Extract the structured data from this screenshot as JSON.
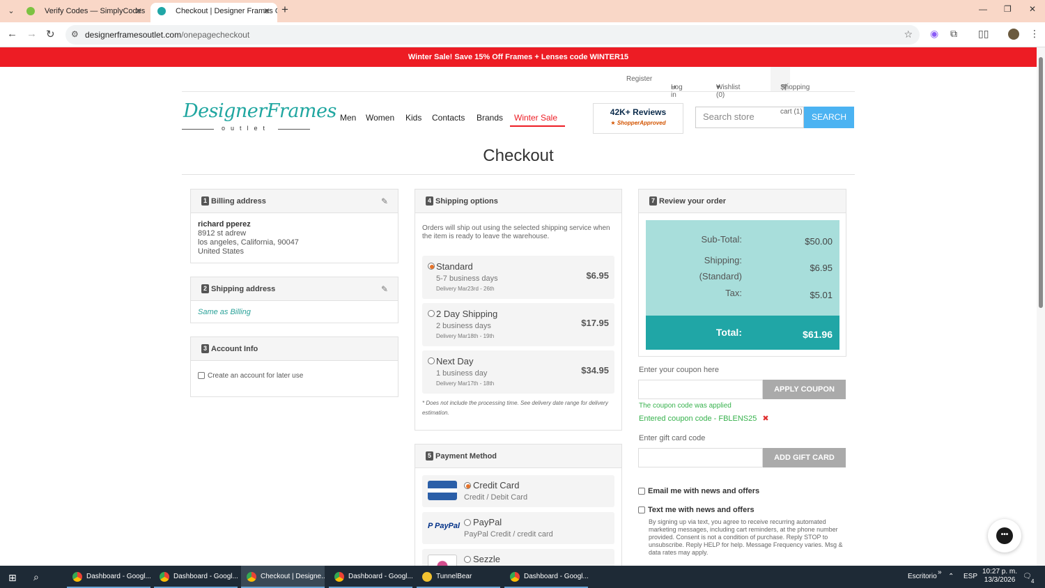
{
  "browser": {
    "tabs": [
      {
        "label": "Verify Codes — SimplyCodes",
        "active": false
      },
      {
        "label": "Checkout | Designer Frames Ou",
        "active": true
      }
    ],
    "url_host": "designerframesoutlet.com",
    "url_path": "/onepagecheckout"
  },
  "promo_banner": "Winter Sale! Save 15% Off Frames + Lenses code WINTER15",
  "top_links": {
    "register": "Register",
    "login": "Log in",
    "wishlist": "Wishlist (0)",
    "cart": "Shopping cart (1)"
  },
  "logo": {
    "word": "DesignerFrames",
    "sub": "outlet"
  },
  "nav": [
    "Men",
    "Women",
    "Kids",
    "Contacts",
    "Brands",
    "Winter Sale"
  ],
  "reviews": {
    "count": "42K+ Reviews",
    "badge": "ShopperApproved"
  },
  "search": {
    "placeholder": "Search store",
    "button": "SEARCH"
  },
  "page_title": "Checkout",
  "billing": {
    "step": "1",
    "title": "Billing address",
    "name": "richard pperez",
    "street": "8912 st adrew",
    "city_line": "los angeles, California, 90047",
    "country": "United States"
  },
  "shipping_address": {
    "step": "2",
    "title": "Shipping address",
    "value": "Same as Billing"
  },
  "account": {
    "step": "3",
    "title": "Account Info",
    "checkbox_label": "Create an account for later use"
  },
  "shipping_options": {
    "step": "4",
    "title": "Shipping options",
    "note": "Orders will ship out using the selected shipping service when the item is ready to leave the warehouse.",
    "options": [
      {
        "name": "Standard",
        "days": "5-7 business days",
        "delivery": "Delivery Mar23rd - 26th",
        "price": "$6.95",
        "selected": true
      },
      {
        "name": "2 Day Shipping",
        "days": "2 business days",
        "delivery": "Delivery Mar18th - 19th",
        "price": "$17.95",
        "selected": false
      },
      {
        "name": "Next Day",
        "days": "1 business day",
        "delivery": "Delivery Mar17th - 18th",
        "price": "$34.95",
        "selected": false
      }
    ],
    "fine_print": "* Does not include the processing time. See delivery date range for delivery estimation."
  },
  "payment": {
    "step": "5",
    "title": "Payment Method",
    "methods": [
      {
        "name": "Credit Card",
        "sub": "Credit / Debit Card",
        "selected": true
      },
      {
        "name": "PayPal",
        "sub": "PayPal Credit / credit card",
        "selected": false
      },
      {
        "name": "Sezzle",
        "sub": "",
        "selected": false
      }
    ]
  },
  "review": {
    "step": "7",
    "title": "Review your order",
    "subtotal_label": "Sub-Total:",
    "subtotal": "$50.00",
    "shipping_label": "Shipping:",
    "shipping_method": "(Standard)",
    "shipping": "$6.95",
    "tax_label": "Tax:",
    "tax": "$5.01",
    "total_label": "Total:",
    "total": "$61.96"
  },
  "coupon": {
    "label": "Enter your coupon here",
    "button": "APPLY COUPON",
    "applied_msg": "The coupon code was applied",
    "entered": "Entered coupon code - FBLENS25",
    "remove": "✖"
  },
  "gift": {
    "label": "Enter gift card code",
    "button": "ADD GIFT CARD"
  },
  "optins": {
    "email": "Email me with news and offers",
    "text": "Text me with news and offers",
    "legal": "By signing up via text, you agree to receive recurring automated marketing messages, including cart reminders, at the phone number provided. Consent is not a condition of purchase. Reply STOP to unsubscribe. Reply HELP for help. Message Frequency varies. Msg & data rates may apply."
  },
  "taskbar": {
    "items": [
      "Dashboard - Googl...",
      "Dashboard - Googl...",
      "Checkout | Designe...",
      "Dashboard - Googl...",
      "TunnelBear",
      "Dashboard - Googl..."
    ],
    "desktop": "Escritorio",
    "lang": "ESP",
    "time": "10:27 p. m.",
    "date": "13/3/2026",
    "notif": "4"
  }
}
